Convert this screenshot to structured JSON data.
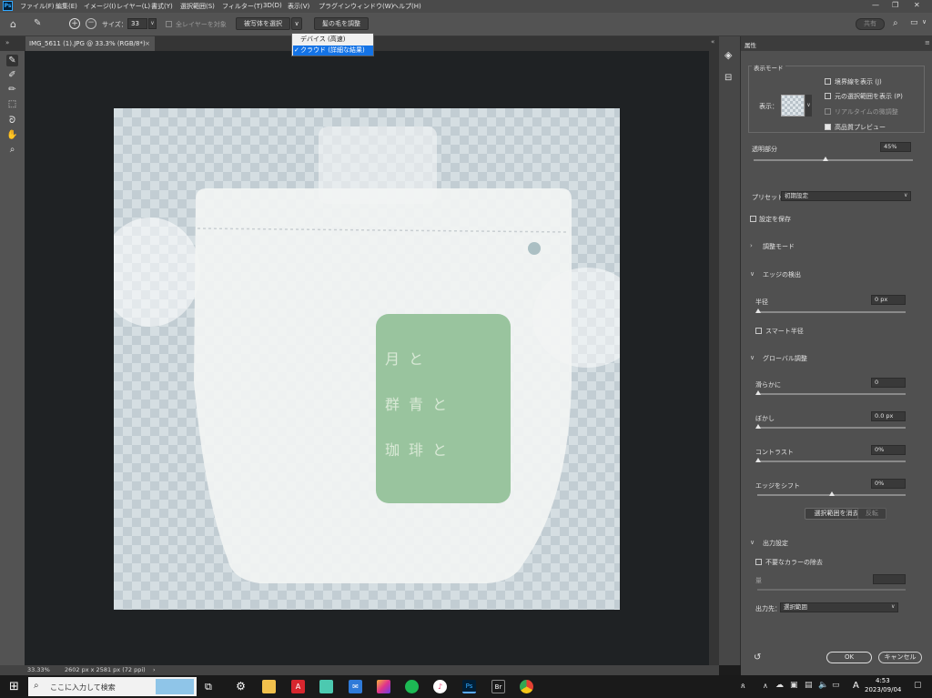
{
  "menubar": {
    "logo": "Ps",
    "items": [
      "ファイル(F)",
      "編集(E)",
      "イメージ(I)",
      "レイヤー(L)",
      "書式(Y)",
      "選択範囲(S)",
      "フィルター(T)",
      "3D(D)",
      "表示(V)",
      "プラグイン",
      "ウィンドウ(W)",
      "ヘルプ(H)"
    ]
  },
  "optbar": {
    "size_label": "サイズ：",
    "size_value": "33",
    "all_layers": "全レイヤーを対象",
    "select_subject": "被写体を選択",
    "refine_hair": "髪の毛を調整",
    "share": "共有"
  },
  "dropdown": {
    "items": [
      {
        "label": "デバイス (高速)",
        "selected": false
      },
      {
        "label": "クラウド (詳細な結果)",
        "selected": true
      }
    ]
  },
  "tab": {
    "title": "IMG_5611 (1).JPG @ 33.3% (RGB/8*)"
  },
  "image": {
    "bag_text": [
      "月と",
      "群青と",
      "珈琲と"
    ]
  },
  "status": {
    "zoom": "33.33%",
    "dims": "2602 px x 2581 px (72 ppi)"
  },
  "panel": {
    "title": "属性",
    "view_mode": "表示モード",
    "view_label": "表示：",
    "show_edge": "境界線を表示 (J)",
    "show_original": "元の選択範囲を表示 (P)",
    "realtime": "リアルタイムの微調整",
    "hq_preview": "高品質プレビュー",
    "transparency": "透明部分",
    "transparency_value": "45%",
    "transparency_level": 0.45,
    "preset_label": "プリセット",
    "preset_value": "初期設定",
    "save_settings": "設定を保存",
    "adjust_mode": "調整モード",
    "edge_detection": "エッジの検出",
    "radius": "半径",
    "radius_value": "0 px",
    "smart_radius": "スマート半径",
    "global_refine": "グローバル調整",
    "smooth": "滑らかに",
    "smooth_value": "0",
    "feather": "ぼかし",
    "feather_value": "0.0 px",
    "contrast": "コントラスト",
    "contrast_value": "0%",
    "shift_edge": "エッジをシフト",
    "shift_value": "0%",
    "clear_selection": "選択範囲を消去",
    "invert": "反転",
    "output_settings": "出力設定",
    "decontaminate": "不要なカラーの除去",
    "amount": "量",
    "output_to": "出力先：",
    "output_value": "選択範囲",
    "ok": "OK",
    "cancel": "キャンセル"
  },
  "taskbar": {
    "search_placeholder": "ここに入力して検索",
    "time": "4:53",
    "date": "2023/09/04",
    "ime": "A"
  }
}
